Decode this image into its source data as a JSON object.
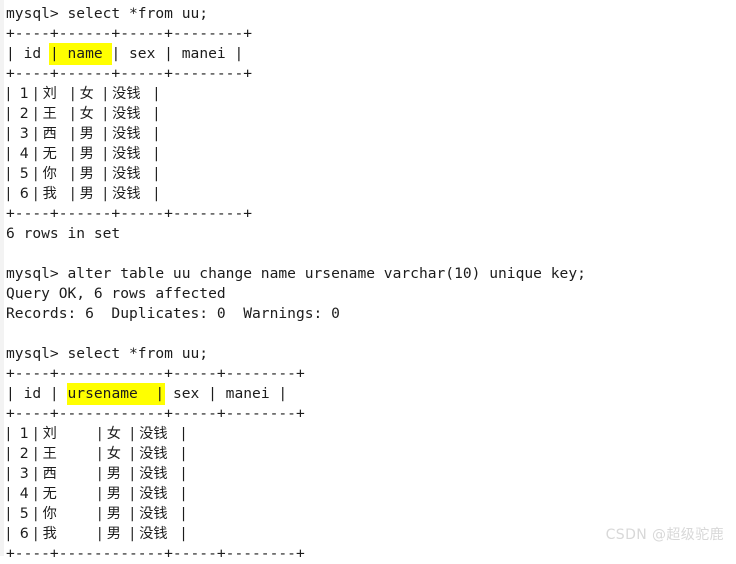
{
  "terminal": {
    "prompt": "mysql> ",
    "lines": [
      {
        "id": "cmd-select-1",
        "type": "command",
        "text": "mysql> select *from uu;"
      },
      {
        "id": "t1-border-top",
        "type": "border",
        "text": "+----+------+-----+--------+"
      },
      {
        "id": "t1-header",
        "type": "header",
        "pre": "| id ",
        "highlight": "| name ",
        "post": "| sex | manei |"
      },
      {
        "id": "t1-border-mid",
        "type": "border",
        "text": "+----+------+-----+--------+"
      },
      {
        "id": "t1-row-1",
        "type": "row",
        "text": "|  1 | 刘   | 女  | 没钱   |"
      },
      {
        "id": "t1-row-2",
        "type": "row",
        "text": "|  2 | 王   | 女  | 没钱   |"
      },
      {
        "id": "t1-row-3",
        "type": "row",
        "text": "|  3 | 西   | 男  | 没钱   |"
      },
      {
        "id": "t1-row-4",
        "type": "row",
        "text": "|  4 | 无   | 男  | 没钱   |"
      },
      {
        "id": "t1-row-5",
        "type": "row",
        "text": "|  5 | 你   | 男  | 没钱   |"
      },
      {
        "id": "t1-row-6",
        "type": "row",
        "text": "|  6 | 我   | 男  | 没钱   |"
      },
      {
        "id": "t1-border-bot",
        "type": "border",
        "text": "+----+------+-----+--------+"
      },
      {
        "id": "t1-rowcount",
        "type": "status",
        "text": "6 rows in set"
      },
      {
        "id": "blank-1",
        "type": "blank",
        "text": " "
      },
      {
        "id": "cmd-alter",
        "type": "command",
        "text": "mysql> alter table uu change name ursename varchar(10) unique key;"
      },
      {
        "id": "alter-result",
        "type": "status",
        "text": "Query OK, 6 rows affected"
      },
      {
        "id": "alter-records",
        "type": "status",
        "text": "Records: 6  Duplicates: 0  Warnings: 0"
      },
      {
        "id": "blank-2",
        "type": "blank",
        "text": " "
      },
      {
        "id": "cmd-select-2",
        "type": "command",
        "text": "mysql> select *from uu;"
      },
      {
        "id": "t2-border-top",
        "type": "border",
        "text": "+----+------------+-----+--------+"
      },
      {
        "id": "t2-header",
        "type": "header",
        "pre": "| id | ",
        "highlight": "ursename  |",
        "post": " sex | manei |"
      },
      {
        "id": "t2-border-mid",
        "type": "border",
        "text": "+----+------------+-----+--------+"
      },
      {
        "id": "t2-row-1",
        "type": "row",
        "text": "|  1 | 刘         | 女  | 没钱   |"
      },
      {
        "id": "t2-row-2",
        "type": "row",
        "text": "|  2 | 王         | 女  | 没钱   |"
      },
      {
        "id": "t2-row-3",
        "type": "row",
        "text": "|  3 | 西         | 男  | 没钱   |"
      },
      {
        "id": "t2-row-4",
        "type": "row",
        "text": "|  4 | 无         | 男  | 没钱   |"
      },
      {
        "id": "t2-row-5",
        "type": "row",
        "text": "|  5 | 你         | 男  | 没钱   |"
      },
      {
        "id": "t2-row-6",
        "type": "row",
        "text": "|  6 | 我         | 男  | 没钱   |"
      },
      {
        "id": "t2-border-bot",
        "type": "border",
        "text": "+----+------------+-----+--------+"
      }
    ]
  },
  "tables": {
    "first_query": {
      "sql": "select *from uu;",
      "columns": [
        "id",
        "name",
        "sex",
        "manei"
      ],
      "highlighted_column": "name",
      "rows": [
        [
          "1",
          "刘",
          "女",
          "没钱"
        ],
        [
          "2",
          "王",
          "女",
          "没钱"
        ],
        [
          "3",
          "西",
          "男",
          "没钱"
        ],
        [
          "4",
          "无",
          "男",
          "没钱"
        ],
        [
          "5",
          "你",
          "男",
          "没钱"
        ],
        [
          "6",
          "我",
          "男",
          "没钱"
        ]
      ],
      "row_count_text": "6 rows in set"
    },
    "alter_statement": {
      "sql": "alter table uu change name ursename varchar(10) unique key;",
      "result": "Query OK, 6 rows affected",
      "records": "Records: 6  Duplicates: 0  Warnings: 0"
    },
    "second_query": {
      "sql": "select *from uu;",
      "columns": [
        "id",
        "ursename",
        "sex",
        "manei"
      ],
      "highlighted_column": "ursename",
      "rows": [
        [
          "1",
          "刘",
          "女",
          "没钱"
        ],
        [
          "2",
          "王",
          "女",
          "没钱"
        ],
        [
          "3",
          "西",
          "男",
          "没钱"
        ],
        [
          "4",
          "无",
          "男",
          "没钱"
        ],
        [
          "5",
          "你",
          "男",
          "没钱"
        ],
        [
          "6",
          "我",
          "男",
          "没钱"
        ]
      ]
    }
  },
  "watermark": {
    "text": "CSDN @超级驼鹿"
  },
  "colors": {
    "background": "#ffffff",
    "text": "#1c1c1c",
    "highlight": "#ffff00",
    "watermark": "#d8d8d8"
  }
}
